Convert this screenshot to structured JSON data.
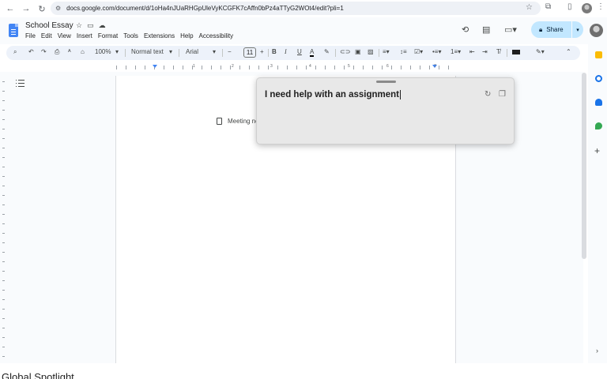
{
  "browser": {
    "url": "docs.google.com/document/d/1oHa4nJUaRHGpUleVyKCGFK7cAffn0bPz4aTTyG2WOt4/edit?pli=1",
    "back_icon": "arrow-left-icon",
    "forward_icon": "arrow-right-icon",
    "reload_icon": "reload-icon"
  },
  "document": {
    "title": "School Essay",
    "menu": [
      "File",
      "Edit",
      "View",
      "Insert",
      "Format",
      "Tools",
      "Extensions",
      "Help",
      "Accessibility"
    ],
    "share_label": "Share"
  },
  "toolbar": {
    "zoom": "100%",
    "style": "Normal text",
    "font": "Arial",
    "font_size": "11",
    "bold": "B",
    "italic": "I",
    "underline": "U",
    "text_color": "A"
  },
  "ruler": {
    "numbers": [
      "1",
      "2",
      "3",
      "4",
      "5",
      "6",
      "7"
    ]
  },
  "page": {
    "chip_label": "Meeting no"
  },
  "spotlight": {
    "query": "I need help with an assignment"
  },
  "footer": {
    "label": "Global Spotlight"
  },
  "colors": {
    "share_bg": "#c2e7ff",
    "accent_blue": "#4285f4",
    "toolbar_bg": "#edf2fa",
    "spotlight_bg": "#e8e8e8"
  }
}
